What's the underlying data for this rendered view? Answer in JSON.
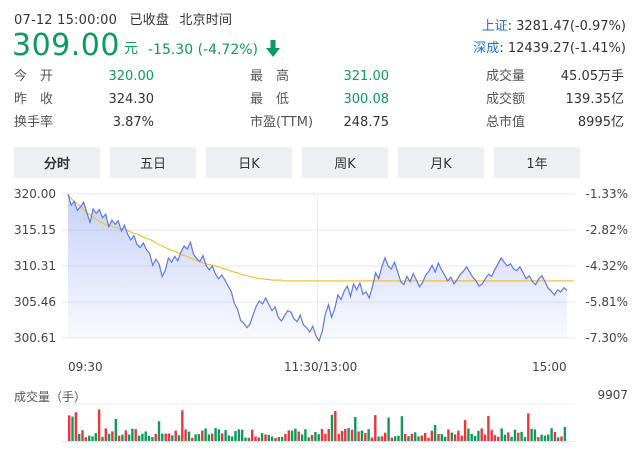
{
  "header": {
    "datetime": "07-12 15:00:00",
    "status": "已收盘",
    "timezone": "北京时间",
    "price": "309.00",
    "unit": "元",
    "change": "-15.30 (-4.72%)"
  },
  "indices": [
    {
      "name": "上证",
      "value": ": 3281.47(-0.97%)"
    },
    {
      "name": "深成",
      "value": ": 12439.27(-1.41%)"
    }
  ],
  "stats": {
    "open_label": "今　开",
    "open": "320.00",
    "prev_label": "昨　收",
    "prev": "324.30",
    "turnover_label": "换手率",
    "turnover": "3.87%",
    "high_label": "最　高",
    "high": "321.00",
    "low_label": "最　低",
    "low": "300.08",
    "pe_label": "市盈(TTM)",
    "pe": "248.75",
    "volume_label": "成交量",
    "volume": "45.05万手",
    "amount_label": "成交额",
    "amount": "139.35亿",
    "mktcap_label": "总市值",
    "mktcap": "8995亿"
  },
  "tabs": [
    {
      "label": "分时",
      "active": true
    },
    {
      "label": "五日",
      "active": false
    },
    {
      "label": "日K",
      "active": false
    },
    {
      "label": "周K",
      "active": false
    },
    {
      "label": "月K",
      "active": false
    },
    {
      "label": "1年",
      "active": false
    }
  ],
  "colors": {
    "down": "#0d9b5c",
    "up": "#e8373b",
    "price_line": "#5e78e8",
    "avg_line": "#f0c23c",
    "index_link": "#1a6fd6"
  },
  "chart_data": {
    "type": "line",
    "price_ticks": [
      "320.00",
      "315.15",
      "310.31",
      "305.46",
      "300.61"
    ],
    "pct_ticks": [
      "-1.33%",
      "-2.82%",
      "-4.32%",
      "-5.81%",
      "-7.30%"
    ],
    "time_ticks": [
      "09:30",
      "11:30/13:00",
      "15:00"
    ],
    "ylim": [
      300.61,
      320.0
    ],
    "volume_title": "成交量（手）",
    "volume_max": "9907",
    "series": [
      {
        "values": [
          320.0,
          318.5,
          319.0,
          317.8,
          318.3,
          318.9,
          317.5,
          316.2,
          318.0,
          317.4,
          317.9,
          316.8,
          317.3,
          315.6,
          316.5,
          315.9,
          316.4,
          315.0,
          315.8,
          314.6,
          313.8,
          314.4,
          313.2,
          312.8,
          313.4,
          312.5,
          312.0,
          310.4,
          311.2,
          310.6,
          308.9,
          309.7,
          311.4,
          310.8,
          311.6,
          311.0,
          312.2,
          313.0,
          312.6,
          313.5,
          311.9,
          311.3,
          310.9,
          311.7,
          310.4,
          309.8,
          310.3,
          309.2,
          308.6,
          309.1,
          308.4,
          307.6,
          306.9,
          305.3,
          304.5,
          303.0,
          302.6,
          302.0,
          302.5,
          303.8,
          304.9,
          305.6,
          305.2,
          306.0,
          305.1,
          304.3,
          304.8,
          303.4,
          302.9,
          303.6,
          304.3,
          304.1,
          303.2,
          302.8,
          303.7,
          302.4,
          302.0,
          301.4,
          302.2,
          300.9,
          300.2,
          301.5,
          303.8,
          305.1,
          303.4,
          304.6,
          306.4,
          305.8,
          306.9,
          307.6,
          306.2,
          307.9,
          307.1,
          308.0,
          306.5,
          306.8,
          306.0,
          307.5,
          309.4,
          308.6,
          310.2,
          311.4,
          310.3,
          309.9,
          310.8,
          309.6,
          308.2,
          307.8,
          308.9,
          308.2,
          309.3,
          308.4,
          307.5,
          308.1,
          309.1,
          309.6,
          310.4,
          309.5,
          310.7,
          309.8,
          309.1,
          308.3,
          308.8,
          307.9,
          308.5,
          309.2,
          309.6,
          310.2,
          309.5,
          308.8,
          308.3,
          307.6,
          307.9,
          308.6,
          309.2,
          308.9,
          309.8,
          310.6,
          311.4,
          310.8,
          310.3,
          310.6,
          309.9,
          309.7,
          310.2,
          309.4,
          308.6,
          309.0,
          308.2,
          307.8,
          308.6,
          309.0,
          308.2,
          307.3,
          306.9,
          306.4,
          307.1,
          306.8,
          307.4,
          307.0
        ],
        "color": "#5e78e8"
      },
      {
        "values": [
          319.9,
          319.4,
          319.0,
          318.7,
          318.3,
          317.9,
          317.5,
          317.2,
          316.9,
          316.6,
          316.3,
          316.1,
          315.9,
          315.7,
          315.6,
          315.5,
          315.4,
          315.3,
          315.2,
          315.1,
          314.9,
          314.7,
          314.6,
          314.4,
          314.2,
          314.0,
          313.9,
          313.7,
          313.4,
          313.2,
          313.0,
          312.8,
          312.6,
          312.4,
          312.3,
          312.1,
          311.9,
          311.7,
          311.6,
          311.4,
          311.2,
          311.0,
          310.9,
          310.7,
          310.6,
          310.5,
          310.4,
          310.3,
          310.2,
          310.0,
          309.9,
          309.8,
          309.6,
          309.5,
          309.4,
          309.2,
          309.1,
          309.0,
          308.9,
          308.8,
          308.7,
          308.6,
          308.6,
          308.5,
          308.5,
          308.4,
          308.4,
          308.4,
          308.4,
          308.3,
          308.3,
          308.3,
          308.3,
          308.3,
          308.3,
          308.3,
          308.3,
          308.3,
          308.3,
          308.3,
          308.3,
          308.3,
          308.3,
          308.3,
          308.3,
          308.3,
          308.3,
          308.3,
          308.3,
          308.3,
          308.3,
          308.3,
          308.3,
          308.3,
          308.3,
          308.3,
          308.3,
          308.3,
          308.3,
          308.3,
          308.3,
          308.3,
          308.3,
          308.3,
          308.3,
          308.3,
          308.3,
          308.3,
          308.3,
          308.3,
          308.3,
          308.3,
          308.3,
          308.3,
          308.3,
          308.3,
          308.3,
          308.3,
          308.3,
          308.3,
          308.3,
          308.3,
          308.3,
          308.3,
          308.3,
          308.3,
          308.3,
          308.3,
          308.3,
          308.3,
          308.3,
          308.3,
          308.3,
          308.3,
          308.3,
          308.3,
          308.3,
          308.3,
          308.3,
          308.3,
          308.3,
          308.3,
          308.3,
          308.3,
          308.3,
          308.3,
          308.3,
          308.3,
          308.3,
          308.3,
          308.3,
          308.3,
          308.3,
          308.3,
          308.3,
          308.3,
          308.3,
          308.3,
          308.3,
          308.3,
          308.3,
          308.3
        ],
        "color": "#f0c23c"
      }
    ]
  }
}
